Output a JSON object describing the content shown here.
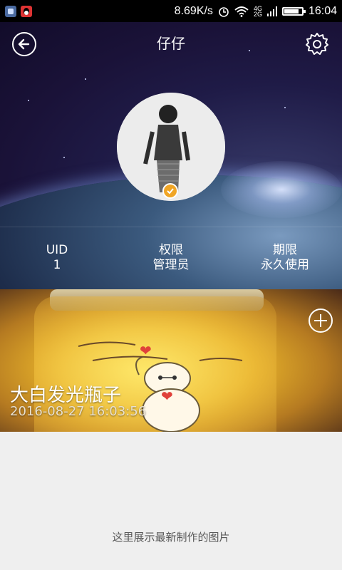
{
  "status_bar": {
    "speed": "8.69K/s",
    "network_top": "4G",
    "network_bottom": "2G",
    "time": "16:04",
    "battery_level": 0.85
  },
  "header": {
    "title": "仔仔",
    "back_icon": "back-arrow-circle-icon",
    "settings_icon": "gear-icon"
  },
  "profile": {
    "info": [
      {
        "label": "UID",
        "value": "1"
      },
      {
        "label": "权限",
        "value": "管理员"
      },
      {
        "label": "期限",
        "value": "永久使用"
      }
    ]
  },
  "latest_image": {
    "title": "大白发光瓶子",
    "date": "2016-08-27 16:03:56",
    "add_icon": "plus-circle-icon"
  },
  "empty_hint": "这里展示最新制作的图片",
  "colors": {
    "header_bg": "#1a1238",
    "badge": "#f0a525",
    "page_bg": "#efefef"
  }
}
